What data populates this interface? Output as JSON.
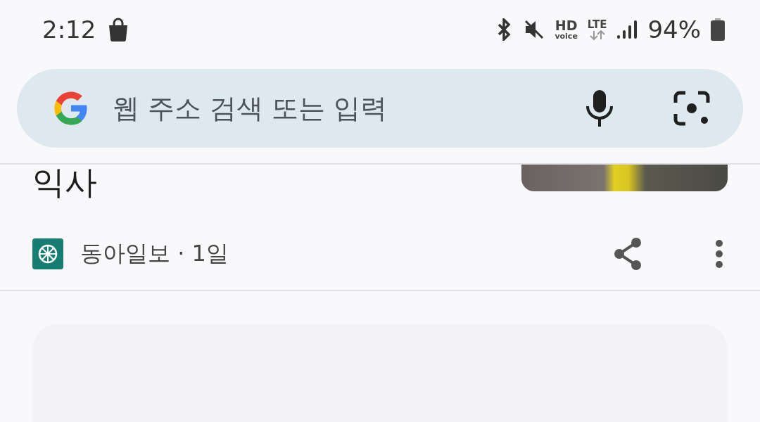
{
  "status_bar": {
    "time": "2:12",
    "hd_label": "HD",
    "voice_label": "voice",
    "network_label": "LTE",
    "battery": "94%"
  },
  "search": {
    "placeholder": "웹 주소 검색 또는 입력"
  },
  "article": {
    "title": "익사",
    "source": "동아일보 · 1일"
  }
}
